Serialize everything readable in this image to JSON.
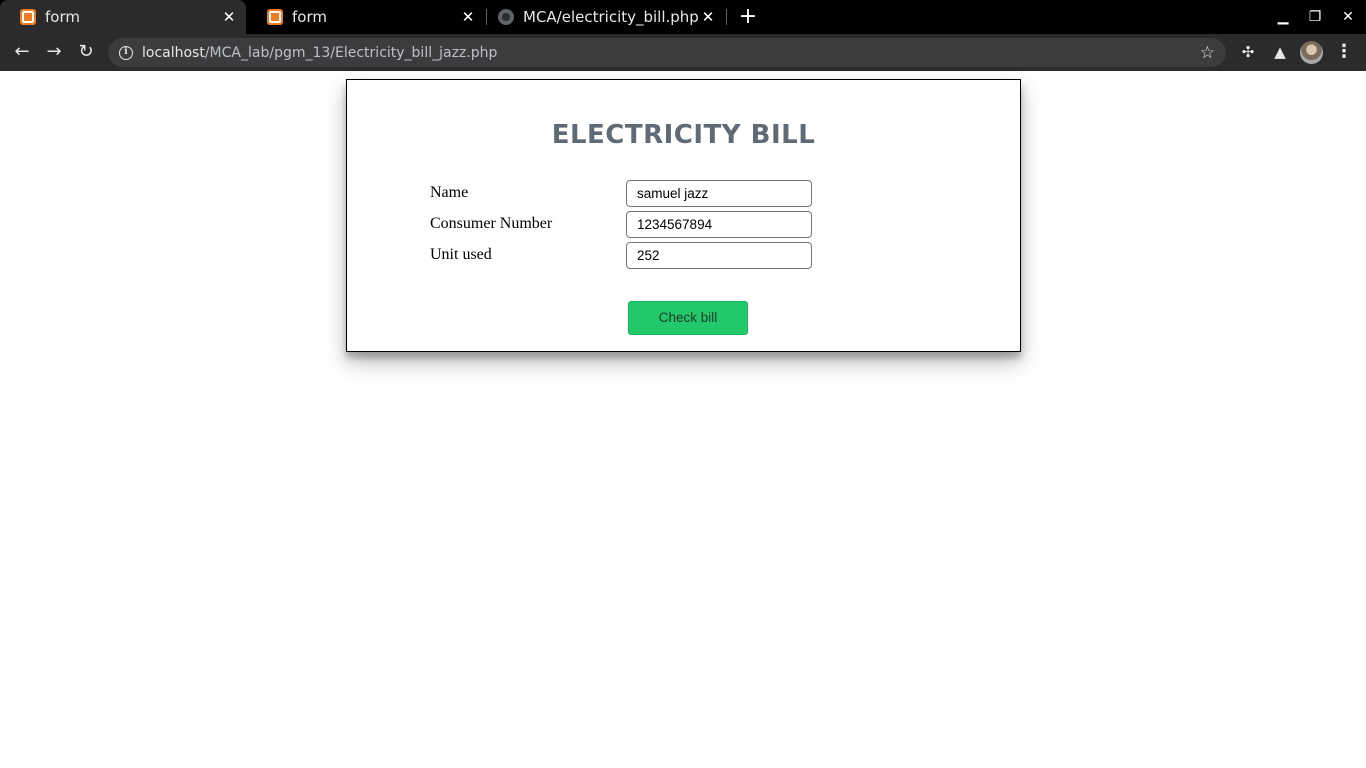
{
  "browser": {
    "tabs": [
      {
        "title": "form",
        "favicon": "xampp-icon",
        "active": true
      },
      {
        "title": "form",
        "favicon": "xampp-icon",
        "active": false
      },
      {
        "title": "MCA/electricity_bill.php",
        "favicon": "github-icon",
        "active": false
      }
    ],
    "url_host": "localhost",
    "url_path": "/MCA_lab/pgm_13/Electricity_bill_jazz.php"
  },
  "page": {
    "heading": "ELECTRICITY BILL",
    "form": {
      "name_label": "Name",
      "name_value": "samuel jazz",
      "consumer_label": "Consumer Number",
      "consumer_value": "1234567894",
      "units_label": "Unit used",
      "units_value": "252",
      "submit_label": "Check bill"
    }
  },
  "colors": {
    "accent_button": "#22c96a",
    "heading": "#5e6a76",
    "chrome_dark": "#000000"
  }
}
